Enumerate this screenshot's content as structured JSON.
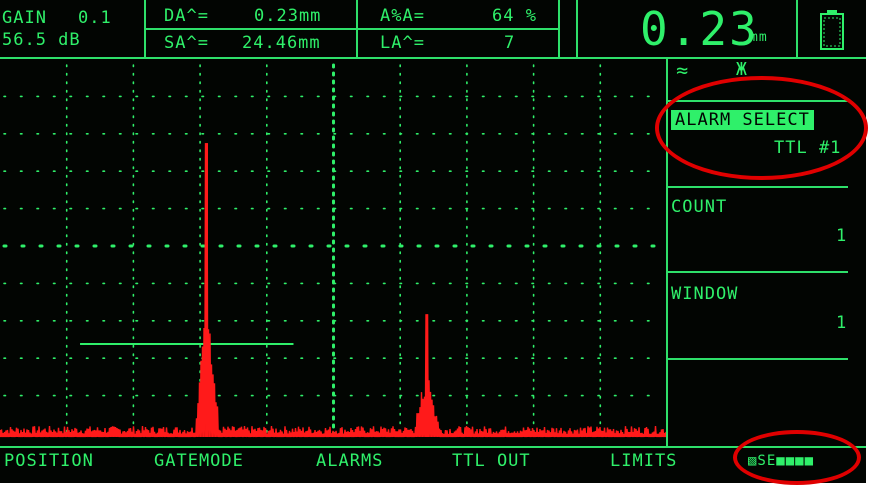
{
  "header": {
    "gain_label": "GAIN",
    "gain_step": "0.1",
    "gain_value": "56.5 dB",
    "da_label": "DA^=",
    "da_value": "0.23mm",
    "sa_label": "SA^=",
    "sa_value": "24.46mm",
    "aa_label": "A%A=",
    "aa_value": "64 %",
    "la_label": "LA^=",
    "la_value": "7",
    "reading_value": "0.23",
    "reading_unit": "mm"
  },
  "status": {
    "rf_symbol": "≈",
    "freeze_symbol": "Ж"
  },
  "menu": {
    "alarm_select_label": "ALARM SELECT",
    "alarm_select_value": "TTL #1",
    "count_label": "COUNT",
    "count_value": "1",
    "window_label": "WINDOW",
    "window_value": "1"
  },
  "bottom_menu": {
    "items": [
      "POSITION",
      "GATEMODE",
      "ALARMS",
      "TTL OUT",
      "LIMITS"
    ],
    "status_indicator": "▧SE■■■■"
  },
  "colors": {
    "screen_bg": "#020502",
    "foreground": "#2ff06a",
    "signal": "#ff1a1a",
    "annotation": "#e00000"
  },
  "icons": {
    "battery": "battery-icon"
  },
  "chart_data": {
    "type": "line",
    "series": [
      {
        "peaks": [
          {
            "x": 0.31,
            "y": 0.79
          },
          {
            "x": 0.64,
            "y": 0.33
          }
        ]
      }
    ],
    "gate": {
      "start": 0.12,
      "end": 0.44,
      "level": 0.25
    },
    "grid": true
  }
}
